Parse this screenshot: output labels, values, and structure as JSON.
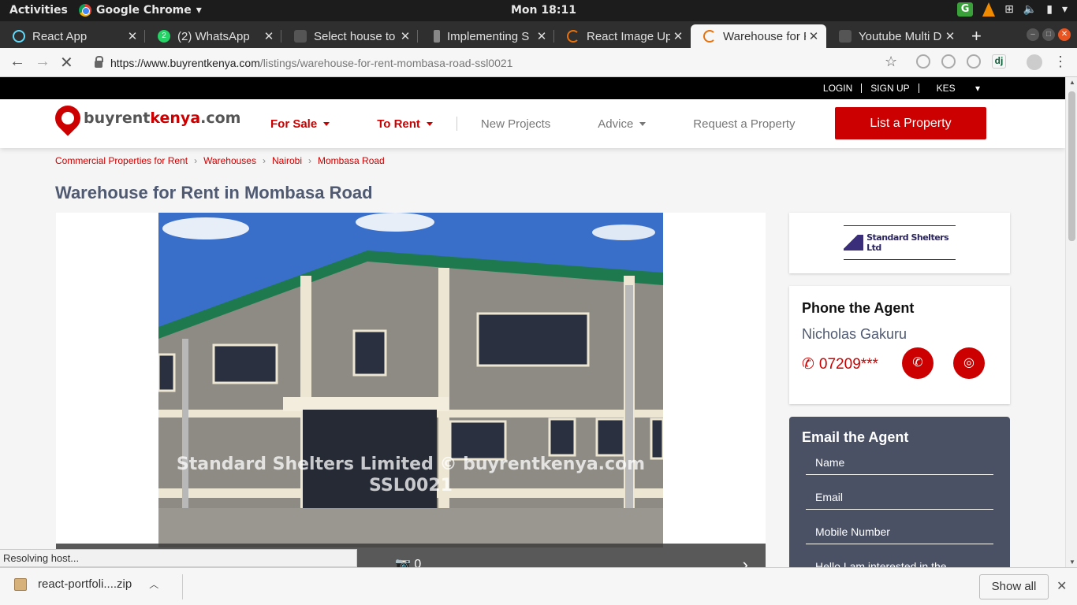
{
  "system": {
    "activities": "Activities",
    "app_name": "Google Chrome",
    "clock": "Mon 18:11"
  },
  "tabs": [
    {
      "title": "React App",
      "icon": "react-icon",
      "active": false
    },
    {
      "title": "(2) WhatsApp",
      "icon": "whatsapp-icon",
      "active": false
    },
    {
      "title": "Select house to",
      "icon": "page-icon",
      "active": false
    },
    {
      "title": "Implementing S",
      "icon": "bulb-icon",
      "active": false
    },
    {
      "title": "React Image Up",
      "icon": "loading-icon",
      "active": false
    },
    {
      "title": "Warehouse for R",
      "icon": "loading-icon",
      "active": true
    },
    {
      "title": "Youtube Multi D",
      "icon": "page-icon",
      "active": false
    }
  ],
  "address_bar": {
    "url_host": "https://www.buyrentkenya.com",
    "url_path": "/listings/warehouse-for-rent-mombasa-road-ssl0021"
  },
  "site": {
    "top_links": {
      "login": "LOGIN",
      "signup": "SIGN UP",
      "currency": "KES"
    },
    "logo": {
      "part1": "buyrent",
      "part2": "kenya",
      "part3": ".com"
    },
    "nav": {
      "for_sale": "For Sale",
      "to_rent": "To Rent",
      "new_projects": "New Projects",
      "advice": "Advice",
      "request": "Request a Property",
      "list_button": "List a Property"
    },
    "breadcrumb": [
      "Commercial Properties for Rent",
      "Warehouses",
      "Nairobi",
      "Mombasa Road"
    ],
    "page_title": "Warehouse for Rent in Mombasa Road",
    "gallery": {
      "watermark_line1": "Standard Shelters Limited © buyrentkenya.com",
      "watermark_line2": "SSL0021",
      "photo_count": "0"
    },
    "agent": {
      "company": "Standard Shelters Ltd",
      "phone_heading": "Phone the Agent",
      "name": "Nicholas Gakuru",
      "phone": "07209***",
      "email_heading": "Email the Agent",
      "fields": {
        "name": "Name",
        "email": "Email",
        "mobile": "Mobile Number",
        "message": "Hello I am interested in the"
      }
    }
  },
  "status": "Resolving host...",
  "downloads": {
    "file": "react-portfoli....zip",
    "show_all": "Show all"
  }
}
